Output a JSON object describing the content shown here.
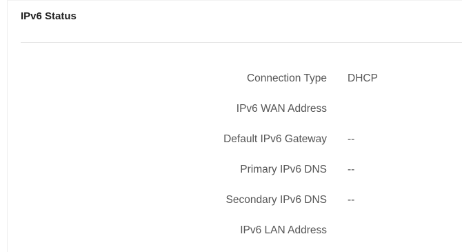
{
  "section": {
    "title": "IPv6 Status"
  },
  "rows": [
    {
      "label": "Connection Type",
      "value": "DHCP"
    },
    {
      "label": "IPv6 WAN Address",
      "value": ""
    },
    {
      "label": "Default IPv6 Gateway",
      "value": "--"
    },
    {
      "label": "Primary IPv6 DNS",
      "value": "--"
    },
    {
      "label": "Secondary IPv6 DNS",
      "value": "--"
    },
    {
      "label": "IPv6 LAN Address",
      "value": ""
    }
  ]
}
